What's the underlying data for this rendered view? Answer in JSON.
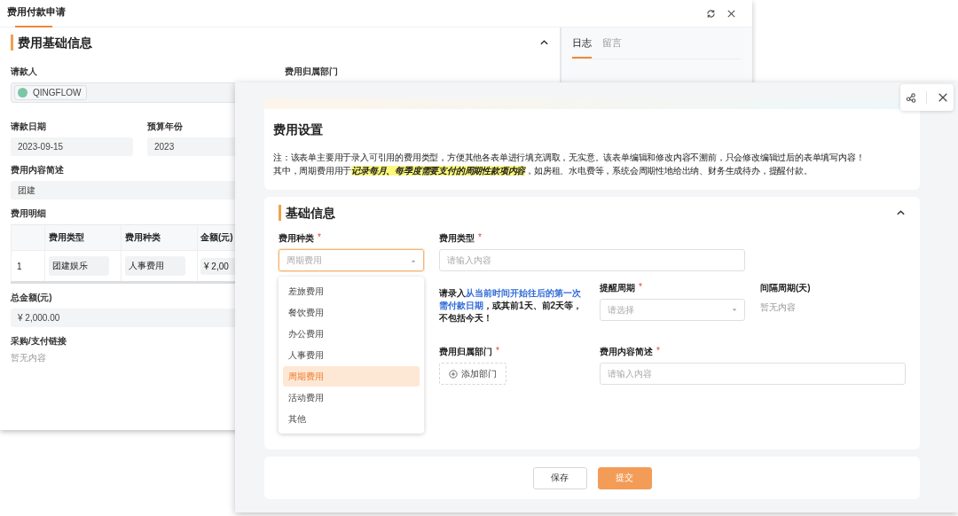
{
  "back_window": {
    "title": "费用付款申请",
    "section": {
      "title": "费用基础信息",
      "expanded": true
    },
    "applicant": {
      "label": "请款人",
      "chip": "QINGFLOW"
    },
    "department": {
      "label": "费用归属部门"
    },
    "date": {
      "label": "请款日期",
      "value": "2023-09-15"
    },
    "year": {
      "label": "预算年份",
      "value": "2023"
    },
    "summary": {
      "label": "费用内容简述",
      "value": "团建"
    },
    "details": {
      "label": "费用明细",
      "columns": [
        "费用类型",
        "费用种类",
        "金额(元)"
      ],
      "rows": [
        {
          "index": "1",
          "cells": [
            "团建娱乐",
            "人事费用",
            "¥ 2,00"
          ]
        }
      ]
    },
    "total": {
      "label": "总金额(元)",
      "value": "¥ 2,000.00"
    },
    "link": {
      "label": "采购/支付链接",
      "value": "暂无内容"
    },
    "side_tabs": [
      {
        "label": "日志",
        "selected": true
      },
      {
        "label": "留言",
        "selected": false
      }
    ]
  },
  "front_window": {
    "settings": {
      "title": "费用设置",
      "note": [
        [
          {
            "text": "注：该表单主要用于录入可引用的费用类型，方便其他各表单进行填充调取，无实意。该表单编辑和修改内容不溯前，只会修改编辑过后的表单填写内容！",
            "highlight": false
          }
        ],
        [
          {
            "text": "其中，周期费用用于",
            "highlight": false
          },
          {
            "text": "记录每月、每季度需要支付的周期性款项内容",
            "highlight": true
          },
          {
            "text": "，如房租、水电费等，系统会周期性地给出纳、财务生成待办，提醒付款。",
            "highlight": false
          }
        ]
      ]
    },
    "form": {
      "title": "基础信息",
      "expanded": true,
      "fields": [
        {
          "kind": "select",
          "label": "费用种类",
          "mark": "*",
          "placeholder": "周期费用",
          "open": true,
          "options": [
            {
              "label": "差旅费用",
              "selected": false
            },
            {
              "label": "餐饮费用",
              "selected": false
            },
            {
              "label": "办公费用",
              "selected": false
            },
            {
              "label": "人事费用",
              "selected": false
            },
            {
              "label": "周期费用",
              "selected": true
            },
            {
              "label": "活动费用",
              "selected": false
            },
            {
              "label": "其他",
              "selected": false
            }
          ]
        },
        {
          "kind": "input",
          "label": "费用类型",
          "mark": "*",
          "placeholder": "请输入内容"
        },
        {
          "kind": "hint",
          "parts": [
            {
              "text": "请录入",
              "highlight": false
            },
            {
              "text": "从当前时间开始往后的第一次需付款日期",
              "highlight": true
            },
            {
              "text": "，或其前1天、前2天等，不包括今天！",
              "highlight": false
            }
          ]
        },
        {
          "kind": "select",
          "label": "提醒周期",
          "mark": "*",
          "placeholder": "请选择",
          "open": false
        },
        {
          "kind": "readonly",
          "label": "间隔周期(天)",
          "value": "暂无内容"
        },
        {
          "kind": "add",
          "label": "费用归属部门",
          "mark": "*",
          "button": "添加部门"
        },
        {
          "kind": "input",
          "label": "费用内容简述",
          "mark": "*",
          "placeholder": "请输入内容"
        }
      ]
    },
    "buttons": [
      {
        "label": "保存",
        "primary": false
      },
      {
        "label": "提交",
        "primary": true
      }
    ]
  }
}
